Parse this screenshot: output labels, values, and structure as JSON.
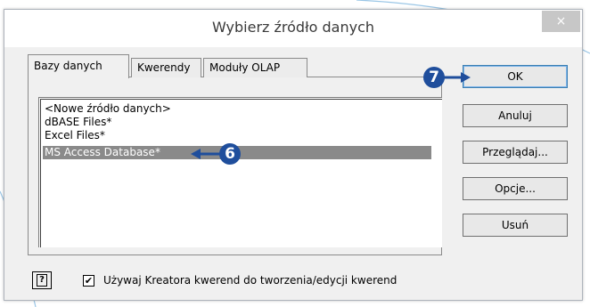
{
  "dialog": {
    "title": "Wybierz źródło danych",
    "close_glyph": "×"
  },
  "tabs": [
    {
      "label": "Bazy danych",
      "active": true
    },
    {
      "label": "Kwerendy",
      "active": false
    },
    {
      "label": "Moduły OLAP",
      "active": false
    }
  ],
  "list": {
    "items": [
      {
        "label": "<Nowe źródło danych>",
        "selected": false
      },
      {
        "label": "dBASE Files*",
        "selected": false
      },
      {
        "label": "Excel Files*",
        "selected": false
      },
      {
        "label": "MS Access Database*",
        "selected": true
      }
    ]
  },
  "buttons": {
    "ok": "OK",
    "cancel": "Anuluj",
    "browse": "Przeglądaj...",
    "options": "Opcje...",
    "delete": "Usuń"
  },
  "callouts": {
    "badge_ok": "7",
    "badge_list": "6"
  },
  "footer": {
    "help_glyph": "?",
    "checkbox_checked": true,
    "checkbox_mark": "✔",
    "checkbox_label": "Używaj Kreatora kwerend do tworzenia/edycji kwerend"
  },
  "colors": {
    "badge": "#1f4e9c",
    "selection": "#8a8a8a",
    "default_button_border": "#3c7fb1"
  }
}
